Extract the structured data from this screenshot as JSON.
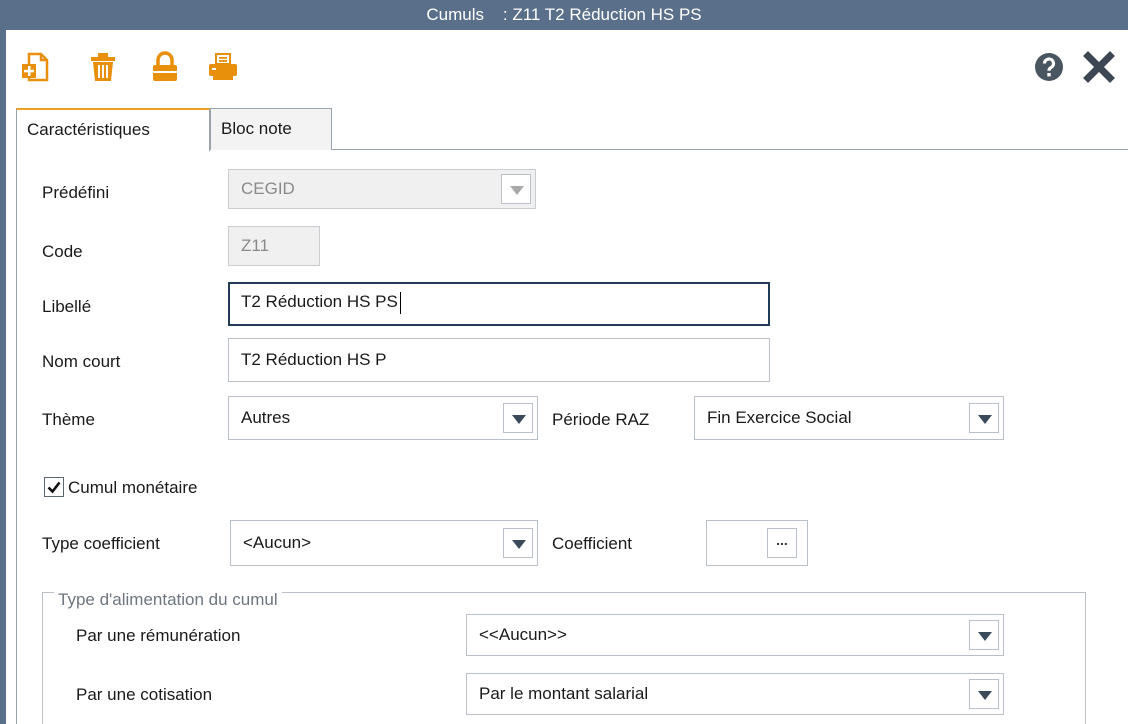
{
  "window": {
    "title": "Cumuls    : Z11 T2 Réduction HS PS"
  },
  "toolbar": {
    "buttons": [
      "new-document-icon",
      "trash-icon",
      "lock-icon",
      "print-icon"
    ],
    "right_buttons": [
      "help-icon",
      "close-icon"
    ],
    "colors": {
      "orange": "#e8900c",
      "help": "#4a5562",
      "close": "#3d4753"
    }
  },
  "tabs": [
    {
      "label": "Caractéristiques",
      "active": true
    },
    {
      "label": "Bloc note",
      "active": false
    }
  ],
  "form": {
    "predefini": {
      "label": "Prédéfini",
      "value": "CEGID"
    },
    "code": {
      "label": "Code",
      "value": "Z11"
    },
    "libelle": {
      "label": "Libellé",
      "value": "T2 Réduction HS PS"
    },
    "nom_court": {
      "label": "Nom court",
      "value": "T2 Réduction HS P"
    },
    "theme": {
      "label": "Thème",
      "value": "Autres"
    },
    "periode_raz": {
      "label": "Période RAZ",
      "value": "Fin Exercice Social"
    },
    "cumul_monetaire": {
      "label": "Cumul monétaire",
      "checked": true
    },
    "type_coefficient": {
      "label": "Type coefficient",
      "value": "<Aucun>"
    },
    "coefficient": {
      "label": "Coefficient",
      "value": "",
      "button": "..."
    }
  },
  "alimentation": {
    "legend": "Type d'alimentation du cumul",
    "remuneration": {
      "label": "Par une rémunération",
      "value": "<<Aucun>>"
    },
    "cotisation": {
      "label": "Par une cotisation",
      "value": "Par le montant salarial"
    }
  }
}
